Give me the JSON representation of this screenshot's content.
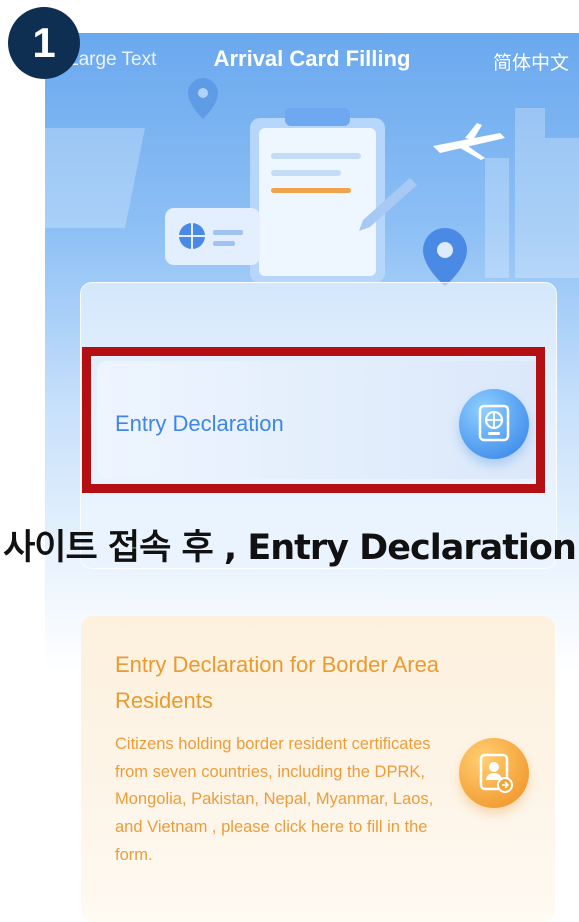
{
  "header": {
    "large_text": "Large Text",
    "title": "Arrival Card Filling",
    "language": "简体中文"
  },
  "cards": {
    "entry_declaration": {
      "label": "Entry Declaration",
      "icon": "globe-passport-icon"
    },
    "border_residents": {
      "title": "Entry Declaration for Border Area Residents",
      "description": "Citizens holding border resident certificates from seven countries, including the DPRK, Mongolia, Pakistan, Nepal, Myanmar, Laos, and Vietnam , please click here to fill in the form.",
      "icon": "resident-certificate-icon"
    }
  },
  "annotation": {
    "step_number": "1",
    "caption": "사이트 접속 후 , Entry Declaration"
  },
  "colors": {
    "accent_blue": "#3f86e5",
    "accent_orange": "#eb9a2e",
    "highlight_red": "#b40f12",
    "badge_navy": "#0f2f52"
  }
}
